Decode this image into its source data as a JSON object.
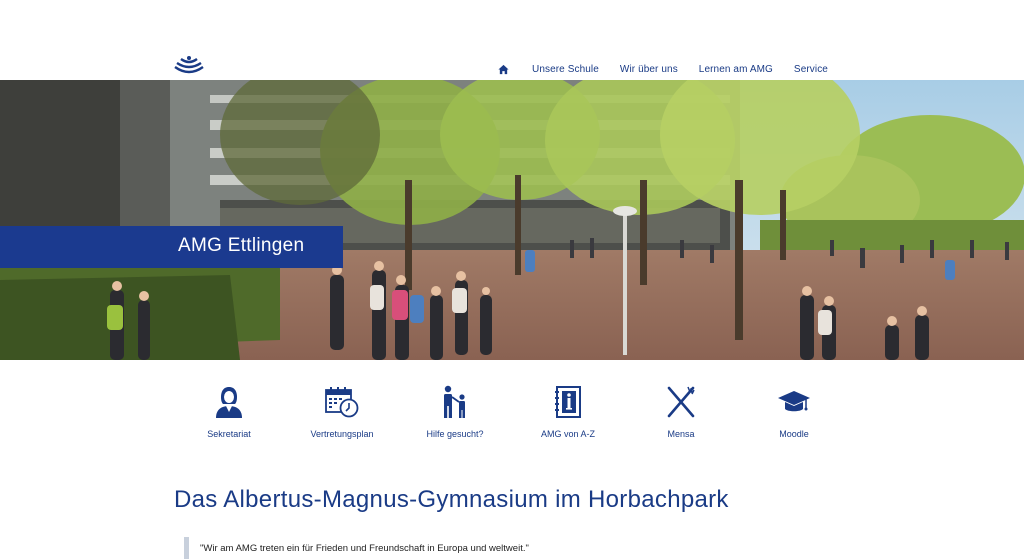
{
  "header": {
    "logo_name": "amg-logo",
    "nav": {
      "home_icon": "home-icon",
      "items": [
        "Unsere Schule",
        "Wir über uns",
        "Lernen am AMG",
        "Service"
      ]
    }
  },
  "hero": {
    "title": "AMG Ettlingen",
    "title_bar_color": "#1b3a8f"
  },
  "quicklinks": [
    {
      "label": "Sekretariat",
      "icon": "secretary-icon"
    },
    {
      "label": "Vertretungsplan",
      "icon": "calendar-clock-icon"
    },
    {
      "label": "Hilfe gesucht?",
      "icon": "parent-child-icon"
    },
    {
      "label": "AMG von A-Z",
      "icon": "info-book-icon"
    },
    {
      "label": "Mensa",
      "icon": "fork-knife-icon"
    },
    {
      "label": "Moodle",
      "icon": "graduation-cap-icon"
    }
  ],
  "main": {
    "title": "Das Albertus-Magnus-Gymnasium im Horbachpark",
    "quote": "\"Wir am AMG treten ein für Frieden und Freundschaft in Europa und weltweit.\""
  },
  "colors": {
    "brand_blue": "#1a3b86",
    "banner_blue": "#1b3a8f"
  }
}
